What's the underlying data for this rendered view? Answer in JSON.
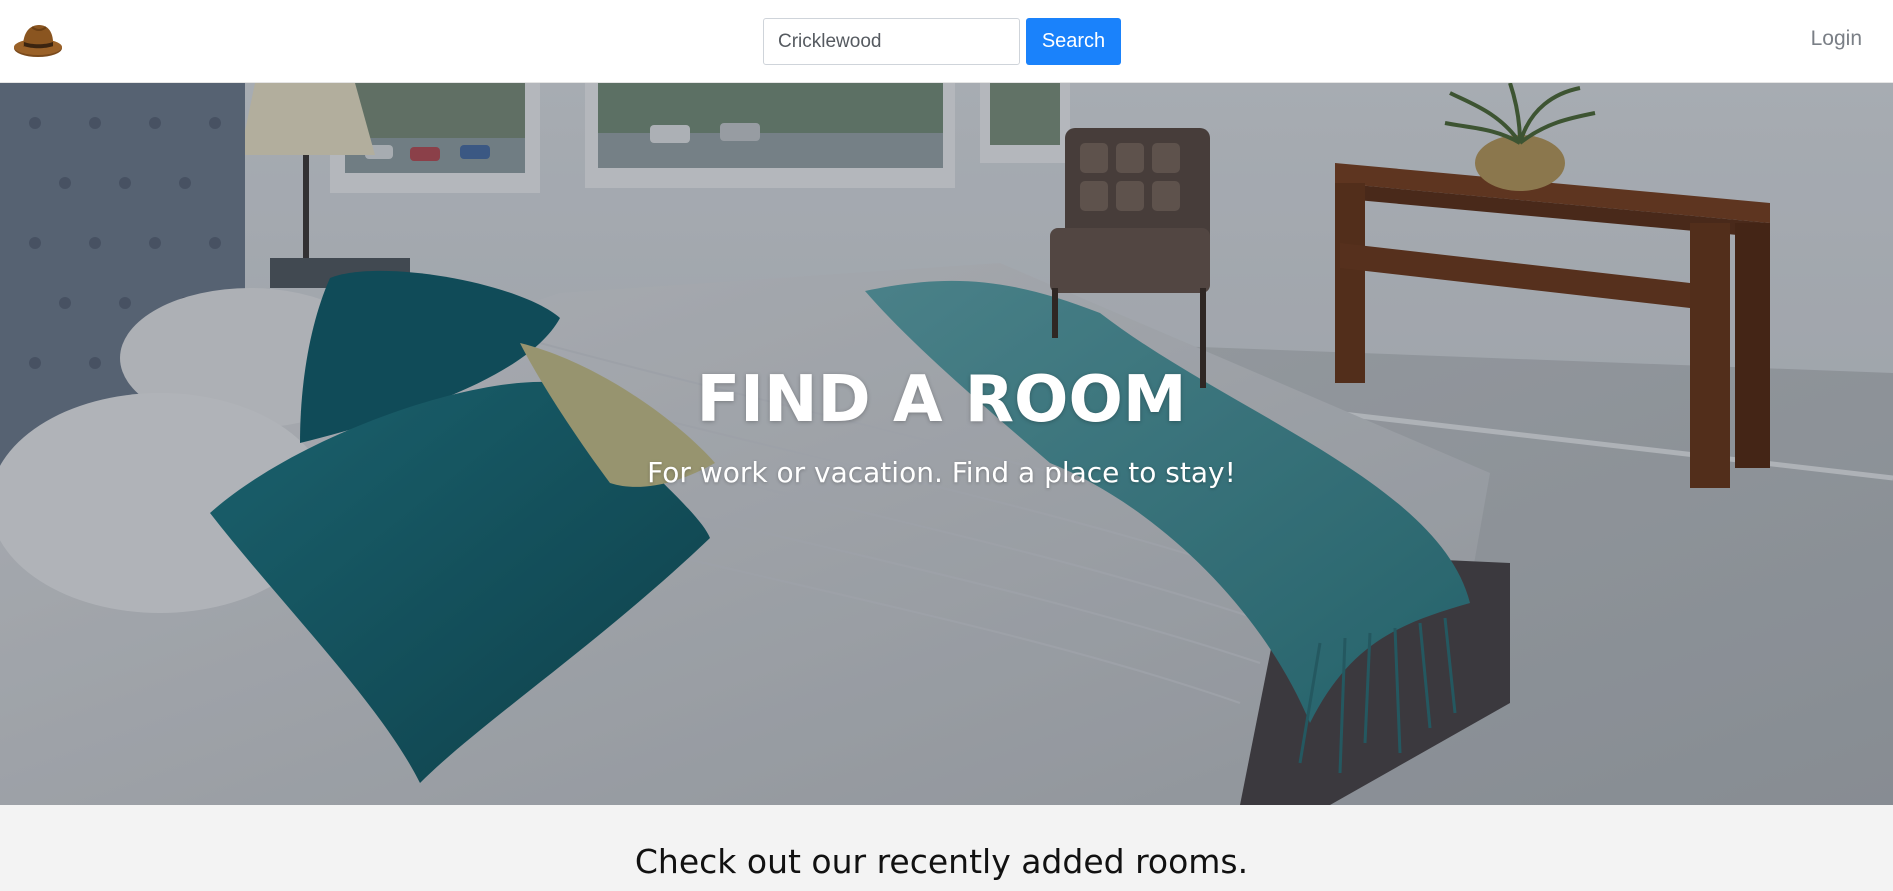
{
  "navbar": {
    "logo_icon": "fedora-hat-icon",
    "search": {
      "value": "Cricklewood",
      "placeholder": "Search",
      "button_label": "Search"
    },
    "login_label": "Login"
  },
  "hero": {
    "title": "FIND A ROOM",
    "subtitle": "For work or vacation. Find a place to stay!",
    "background": "bedroom-photo"
  },
  "recent": {
    "heading": "Check out our recently added rooms."
  },
  "colors": {
    "accent": "#1a82fb",
    "login_text": "#7a7f86",
    "recent_bg": "#f3f3f3"
  }
}
